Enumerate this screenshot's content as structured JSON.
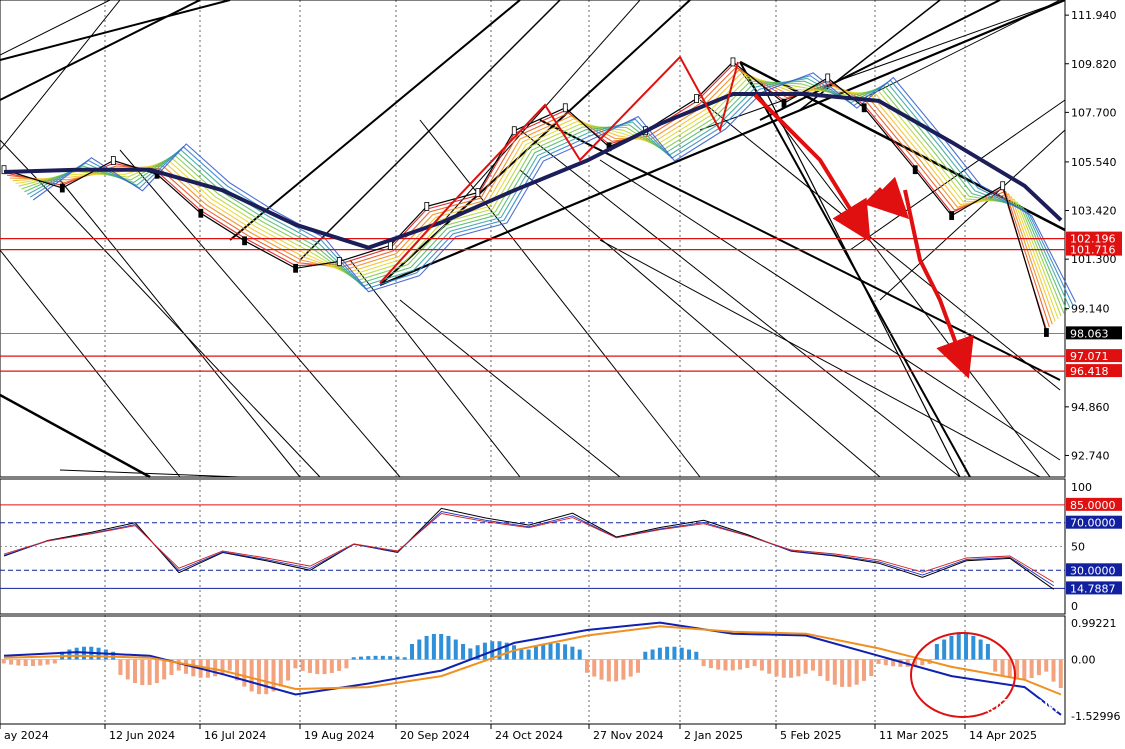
{
  "chart_data": {
    "type": "line",
    "title": "",
    "main_panel": {
      "y_ticks": [
        "111.940",
        "109.820",
        "107.700",
        "105.540",
        "103.420",
        "101.300",
        "99.140",
        "94.860",
        "92.740"
      ],
      "ylim": [
        91.8,
        112.6
      ],
      "price_series": {
        "x_index": [
          0,
          8,
          15,
          21,
          27,
          33,
          40,
          46,
          53,
          58,
          65,
          70,
          77,
          83,
          88,
          95,
          100,
          107,
          113,
          118,
          125,
          130,
          137,
          143
        ],
        "close": [
          105.2,
          104.4,
          105.6,
          105.0,
          103.3,
          102.1,
          100.9,
          101.2,
          101.9,
          103.6,
          104.2,
          106.9,
          107.9,
          106.2,
          106.9,
          108.3,
          109.9,
          108.1,
          109.2,
          107.9,
          105.2,
          103.2,
          104.5,
          98.1
        ]
      },
      "ma_series": {
        "x_index": [
          0,
          10,
          20,
          30,
          40,
          50,
          60,
          70,
          80,
          90,
          100,
          110,
          120,
          130,
          140,
          145
        ],
        "values": [
          105.1,
          105.2,
          105.2,
          104.3,
          102.8,
          101.8,
          102.9,
          104.3,
          105.6,
          107.2,
          108.5,
          108.5,
          108.2,
          106.4,
          104.5,
          103.0
        ]
      },
      "horizontal_levels": [
        {
          "label": "102.196",
          "value": 102.196,
          "color": "#e01010"
        },
        {
          "label": "101.716",
          "value": 101.716,
          "color": "#e01010"
        },
        {
          "label": "98.063",
          "value": 98.063,
          "color": "#3050d0"
        },
        {
          "label": "97.071",
          "value": 97.071,
          "color": "#e01010"
        },
        {
          "label": "96.418",
          "value": 96.418,
          "color": "#e01010"
        }
      ]
    },
    "rsi_panel": {
      "y_ticks": [
        "100",
        "50",
        "0"
      ],
      "ylim": [
        0,
        100
      ],
      "levels": [
        {
          "label": "85.0000",
          "value": 85,
          "color": "#e01010"
        },
        {
          "label": "70.0000",
          "value": 70,
          "color": "#1020a0"
        },
        {
          "label": "30.0000",
          "value": 30,
          "color": "#1020a0"
        },
        {
          "label": "14.7887",
          "value": 14.79,
          "color": "#1020a0"
        }
      ],
      "series": {
        "x_index": [
          0,
          6,
          12,
          18,
          24,
          30,
          36,
          42,
          48,
          54,
          60,
          66,
          72,
          78,
          84,
          90,
          96,
          102,
          108,
          114,
          120,
          126,
          132,
          138,
          144
        ],
        "values": [
          42,
          55,
          62,
          70,
          28,
          45,
          38,
          30,
          52,
          45,
          82,
          74,
          68,
          78,
          58,
          66,
          72,
          60,
          46,
          42,
          36,
          24,
          38,
          40,
          14
        ]
      }
    },
    "macd_panel": {
      "y_ticks": [
        "0.99221",
        "0.00",
        "-1.52996"
      ],
      "ylim": [
        -1.75,
        1.18
      ],
      "histogram": {
        "x_index": [
          0,
          8,
          16,
          24,
          32,
          40,
          48,
          56,
          64,
          72,
          80,
          88,
          96,
          104,
          112,
          120,
          128,
          136,
          144
        ],
        "values": [
          -0.18,
          0.35,
          -0.7,
          -0.5,
          -0.95,
          -0.4,
          0.1,
          0.7,
          0.5,
          0.45,
          -0.6,
          0.35,
          -0.3,
          -0.5,
          -0.75,
          -0.2,
          0.7,
          -0.55,
          -1.0
        ]
      },
      "macd_line": {
        "x_index": [
          0,
          10,
          20,
          30,
          40,
          50,
          60,
          70,
          80,
          90,
          100,
          110,
          120,
          130,
          140,
          145
        ],
        "values": [
          0.1,
          0.2,
          0.1,
          -0.4,
          -0.95,
          -0.65,
          -0.3,
          0.45,
          0.8,
          1.0,
          0.7,
          0.65,
          0.1,
          -0.45,
          -0.75,
          -1.5
        ]
      },
      "signal_line": {
        "x_index": [
          0,
          10,
          20,
          30,
          40,
          50,
          60,
          70,
          80,
          90,
          100,
          110,
          120,
          130,
          140,
          145
        ],
        "values": [
          0.05,
          0.1,
          0.05,
          -0.3,
          -0.8,
          -0.75,
          -0.45,
          0.25,
          0.65,
          0.9,
          0.75,
          0.7,
          0.3,
          -0.2,
          -0.55,
          -0.95
        ]
      }
    },
    "x_ticks": [
      "ay 2024",
      "12 Jun 2024",
      "16 Jul 2024",
      "19 Aug 2024",
      "20 Sep 2024",
      "24 Oct 2024",
      "27 Nov 2024",
      "2 Jan 2025",
      "5 Feb 2025",
      "11 Mar 2025",
      "14 Apr 2025"
    ],
    "watermark": "@TMGM"
  }
}
